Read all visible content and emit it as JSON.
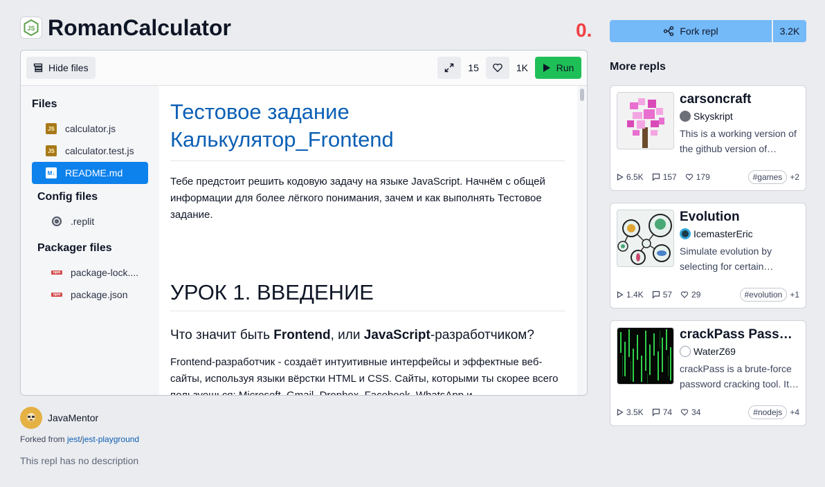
{
  "header": {
    "app_title": "RomanCalculator",
    "counter": "0."
  },
  "toolbar": {
    "hide_files_label": "Hide files",
    "fullscreen_count": "15",
    "likes_count": "1K",
    "run_label": "Run"
  },
  "sidebar": {
    "files_title": "Files",
    "files": [
      {
        "name": "calculator.js",
        "icon": "js-file-icon"
      },
      {
        "name": "calculator.test.js",
        "icon": "js-file-icon"
      },
      {
        "name": "README.md",
        "icon": "markdown-file-icon",
        "active": true
      }
    ],
    "config_title": "Config files",
    "config_files": [
      {
        "name": ".replit",
        "icon": "replit-config-icon"
      }
    ],
    "packager_title": "Packager files",
    "packager_files": [
      {
        "name": "package-lock....",
        "icon": "npm-icon"
      },
      {
        "name": "package.json",
        "icon": "npm-icon"
      }
    ]
  },
  "readme": {
    "title_line1": "Тестовое задание",
    "title_line2": "Калькулятор_Frontend",
    "intro": "Тебе предстоит решить кодовую задачу на языке JavaScript. Начнём с общей информации для более лёгкого понимания, зачем и как выполнять Тестовое задание.",
    "lesson_heading": "УРОК 1. ВВЕДЕНИЕ",
    "question_pre": "Что значит быть ",
    "question_bold1": "Frontend",
    "question_mid": ", или ",
    "question_bold2": "JavaScript",
    "question_post": "-разработчиком?",
    "body": "Frontend-разработчик - создаёт интуитивные интерфейсы и эффектные веб-сайты, используя языки вёрстки HTML и CSS. Сайты, которыми ты скорее всего пользуешься: Microsoft, Gmail, Dropbox, Facebook, WhatsApp и"
  },
  "author": {
    "name": "JavaMentor",
    "forked_prefix": "Forked from ",
    "forked_user": "jest",
    "forked_sep": "/",
    "forked_repl": "jest-playground",
    "description": "This repl has no description"
  },
  "fork": {
    "label": "Fork repl",
    "count": "3.2K"
  },
  "more_repls": {
    "title": "More repls",
    "cards": [
      {
        "title": "carsoncraft",
        "user": "Skyskript",
        "desc": "This is a working version of the github version of…",
        "runs": "6.5K",
        "comments": "157",
        "likes": "179",
        "tag": "#games",
        "more": "+2"
      },
      {
        "title": "Evolution",
        "user": "IcemasterEric",
        "desc": "Simulate evolution by selecting for certain…",
        "runs": "1.4K",
        "comments": "57",
        "likes": "29",
        "tag": "#evolution",
        "more": "+1"
      },
      {
        "title": "crackPass Passw…",
        "user": "WaterZ69",
        "desc": "crackPass is a brute-force password cracking tool. It…",
        "runs": "3.5K",
        "comments": "74",
        "likes": "34",
        "tag": "#nodejs",
        "more": "+4"
      }
    ]
  },
  "colors": {
    "accent": "#0d82ec",
    "run": "#1fbf57",
    "fork": "#74b9f8",
    "counter": "#f23f42",
    "link": "#0b5fb5"
  }
}
